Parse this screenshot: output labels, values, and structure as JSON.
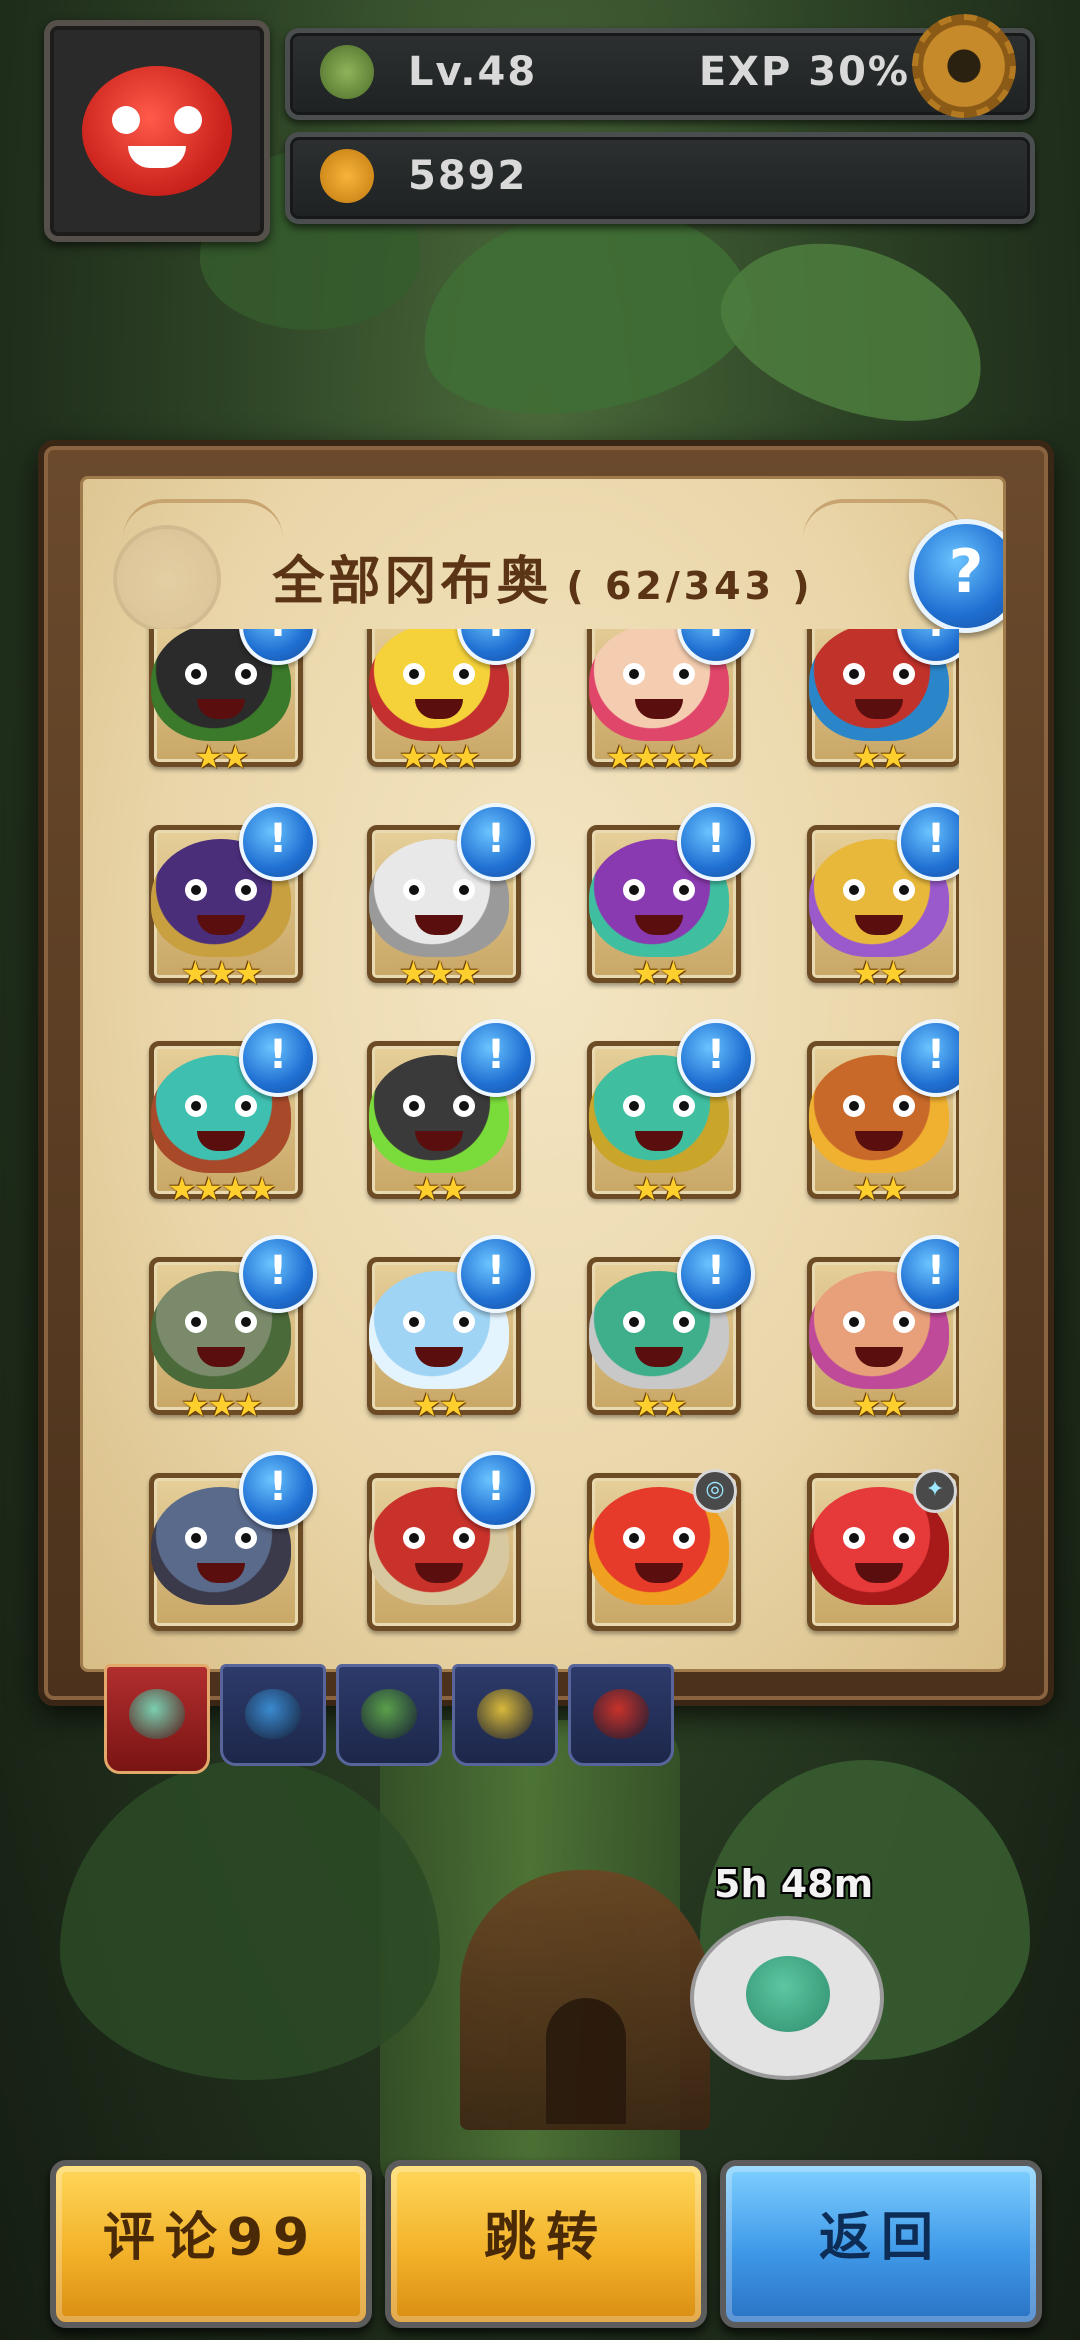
{
  "hud": {
    "level": "Lv.48",
    "exp": "EXP 30%",
    "currency": "5892"
  },
  "panel": {
    "title": "全部冈布奥",
    "count": "( 62/343 )",
    "help": "?"
  },
  "monsters": [
    {
      "stars": "★★",
      "alert": "!",
      "color": "#2b2b2b",
      "accent": "#3a7a2a"
    },
    {
      "stars": "★★★",
      "alert": "!",
      "color": "#f5d23a",
      "accent": "#c43030"
    },
    {
      "stars": "★★★★",
      "alert": "!",
      "color": "#f4cdb0",
      "accent": "#e0466a"
    },
    {
      "stars": "★★",
      "alert": "!",
      "color": "#c0322a",
      "accent": "#2a86c9"
    },
    {
      "stars": "★★★",
      "alert": "!",
      "color": "#4a2e7a",
      "accent": "#c8a040"
    },
    {
      "stars": "★★★",
      "alert": "!",
      "color": "#e8e8e8",
      "accent": "#9a9a9a"
    },
    {
      "stars": "★★",
      "alert": "!",
      "color": "#8a3ab0",
      "accent": "#3fbfa0"
    },
    {
      "stars": "★★",
      "alert": "!",
      "color": "#e8b83a",
      "accent": "#9a5acc"
    },
    {
      "stars": "★★★★",
      "alert": "!",
      "color": "#3fbfb0",
      "accent": "#a84a2a"
    },
    {
      "stars": "★★",
      "alert": "!",
      "color": "#3a3a3a",
      "accent": "#7adc3a"
    },
    {
      "stars": "★★",
      "alert": "!",
      "color": "#3fbfa0",
      "accent": "#c9a52a"
    },
    {
      "stars": "★★",
      "alert": "!",
      "color": "#c8692a",
      "accent": "#f0b030"
    },
    {
      "stars": "★★★",
      "alert": "!",
      "color": "#7a8a6a",
      "accent": "#4a6a3a"
    },
    {
      "stars": "★★",
      "alert": "!",
      "color": "#9fd4f4",
      "accent": "#e4f4ff"
    },
    {
      "stars": "★★",
      "alert": "!",
      "color": "#3fae8a",
      "accent": "#c8c8c8"
    },
    {
      "stars": "★★",
      "alert": "!",
      "color": "#e8a07a",
      "accent": "#c04a9a"
    },
    {
      "stars": "",
      "alert": "!",
      "color": "#5a6a8a",
      "accent": "#3a3a4a"
    },
    {
      "stars": "",
      "alert": "!",
      "color": "#c8322a",
      "accent": "#d8c8a0"
    },
    {
      "stars": "",
      "alert": "◎",
      "color": "#e63a2a",
      "accent": "#f0a020"
    },
    {
      "stars": "",
      "alert": "✦",
      "color": "#e63a3a",
      "accent": "#a81a1a"
    }
  ],
  "tabs": [
    {
      "color": "#7acfb0"
    },
    {
      "color": "#3a8ad0"
    },
    {
      "color": "#5aa04a"
    },
    {
      "color": "#d8b83a"
    },
    {
      "color": "#c8322a"
    }
  ],
  "timer": "5h 48m",
  "buttons": {
    "review": "评论99",
    "jump": "跳转",
    "back": "返回"
  }
}
